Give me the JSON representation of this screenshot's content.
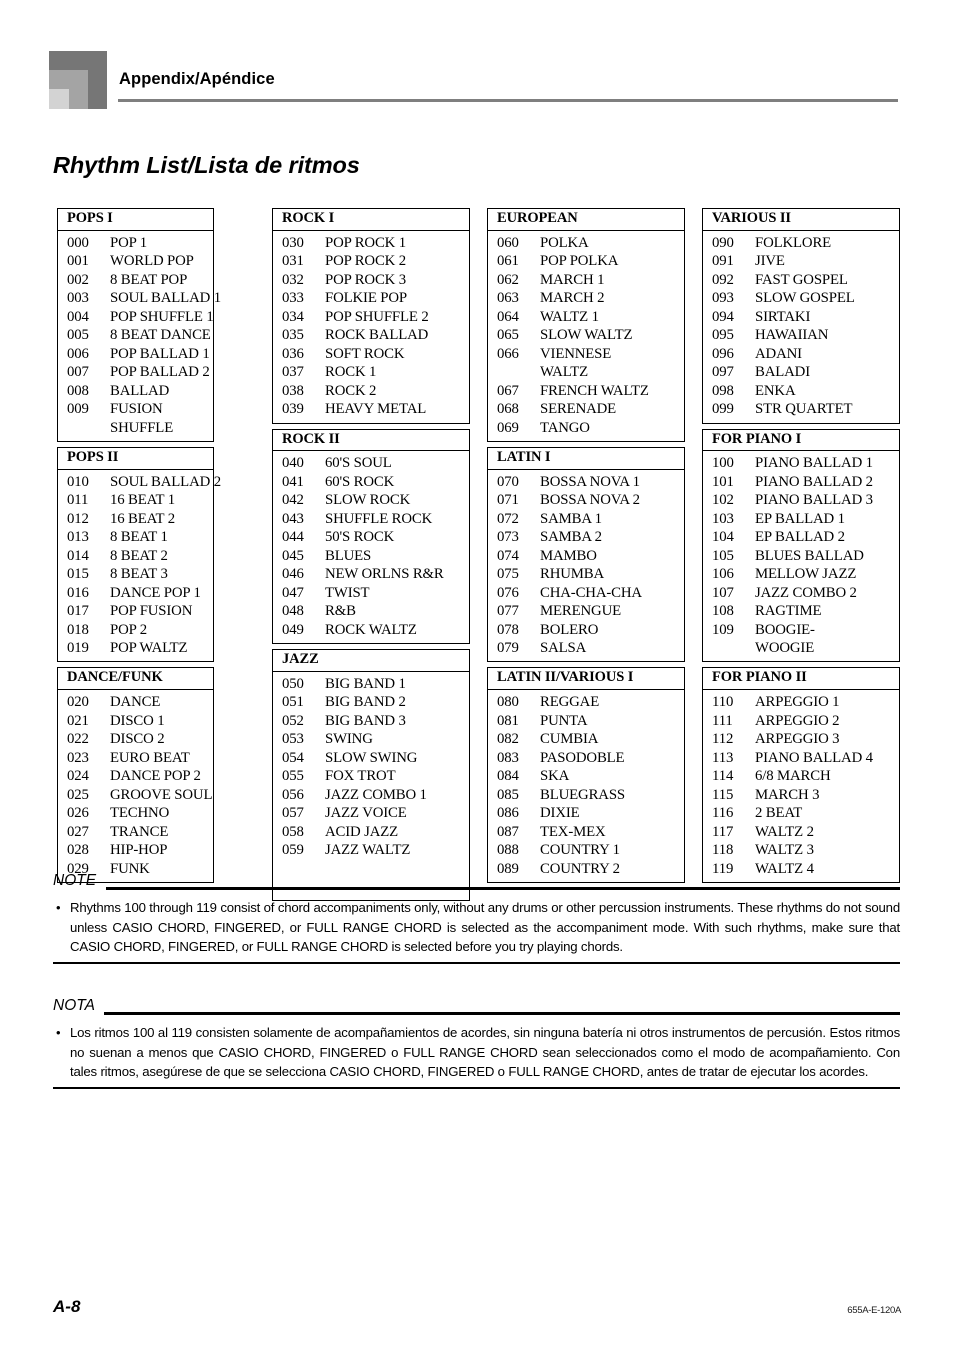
{
  "header": {
    "breadcrumb": "Appendix/Apéndice",
    "logo_icon": "stepped-squares-logo",
    "rule_color": "#7f7f7f",
    "logo_colors": [
      "#767676",
      "#a4a4a4",
      "#d3d3d3"
    ]
  },
  "page_title": "Rhythm List/Lista de ritmos",
  "columns": [
    {
      "groups": [
        {
          "title": "POPS I",
          "rows": [
            {
              "num": "000",
              "name": "POP 1"
            },
            {
              "num": "001",
              "name": "WORLD POP"
            },
            {
              "num": "002",
              "name": "8 BEAT POP"
            },
            {
              "num": "003",
              "name": "SOUL BALLAD 1"
            },
            {
              "num": "004",
              "name": "POP SHUFFLE 1"
            },
            {
              "num": "005",
              "name": "8 BEAT DANCE"
            },
            {
              "num": "006",
              "name": "POP BALLAD 1"
            },
            {
              "num": "007",
              "name": "POP BALLAD 2"
            },
            {
              "num": "008",
              "name": "BALLAD"
            },
            {
              "num": "009",
              "name": "FUSION"
            },
            {
              "num": "",
              "name": "SHUFFLE",
              "continuation": true
            }
          ]
        },
        {
          "title": "POPS II",
          "rows": [
            {
              "num": "010",
              "name": "SOUL BALLAD 2"
            },
            {
              "num": "011",
              "name": "16 BEAT 1"
            },
            {
              "num": "012",
              "name": "16 BEAT 2"
            },
            {
              "num": "013",
              "name": "8 BEAT 1"
            },
            {
              "num": "014",
              "name": "8 BEAT 2"
            },
            {
              "num": "015",
              "name": "8 BEAT 3"
            },
            {
              "num": "016",
              "name": "DANCE POP 1"
            },
            {
              "num": "017",
              "name": "POP FUSION"
            },
            {
              "num": "018",
              "name": "POP 2"
            },
            {
              "num": "019",
              "name": "POP WALTZ"
            }
          ]
        },
        {
          "title": "DANCE/FUNK",
          "rows": [
            {
              "num": "020",
              "name": "DANCE"
            },
            {
              "num": "021",
              "name": "DISCO 1"
            },
            {
              "num": "022",
              "name": "DISCO 2"
            },
            {
              "num": "023",
              "name": "EURO BEAT"
            },
            {
              "num": "024",
              "name": "DANCE POP 2"
            },
            {
              "num": "025",
              "name": "GROOVE SOUL"
            },
            {
              "num": "026",
              "name": "TECHNO"
            },
            {
              "num": "027",
              "name": "TRANCE"
            },
            {
              "num": "028",
              "name": "HIP-HOP"
            },
            {
              "num": "029",
              "name": "FUNK"
            }
          ]
        }
      ]
    },
    {
      "groups": [
        {
          "title": "ROCK I",
          "rows": [
            {
              "num": "030",
              "name": "POP ROCK 1"
            },
            {
              "num": "031",
              "name": "POP ROCK 2"
            },
            {
              "num": "032",
              "name": "POP ROCK 3"
            },
            {
              "num": "033",
              "name": "FOLKIE POP"
            },
            {
              "num": "034",
              "name": "POP SHUFFLE 2"
            },
            {
              "num": "035",
              "name": "ROCK BALLAD"
            },
            {
              "num": "036",
              "name": "SOFT ROCK"
            },
            {
              "num": "037",
              "name": "ROCK 1"
            },
            {
              "num": "038",
              "name": "ROCK 2"
            },
            {
              "num": "039",
              "name": "HEAVY METAL"
            }
          ]
        },
        {
          "title": "ROCK II",
          "rows": [
            {
              "num": "040",
              "name": "60'S SOUL"
            },
            {
              "num": "041",
              "name": "60'S ROCK"
            },
            {
              "num": "042",
              "name": "SLOW ROCK"
            },
            {
              "num": "043",
              "name": "SHUFFLE ROCK"
            },
            {
              "num": "044",
              "name": "50'S ROCK"
            },
            {
              "num": "045",
              "name": "BLUES"
            },
            {
              "num": "046",
              "name": "NEW ORLNS R&R"
            },
            {
              "num": "047",
              "name": "TWIST"
            },
            {
              "num": "048",
              "name": "R&B"
            },
            {
              "num": "049",
              "name": "ROCK WALTZ"
            }
          ]
        },
        {
          "title": "JAZZ",
          "trailing_blank_rows": 2,
          "rows": [
            {
              "num": "050",
              "name": "BIG BAND 1"
            },
            {
              "num": "051",
              "name": "BIG BAND 2"
            },
            {
              "num": "052",
              "name": "BIG BAND 3"
            },
            {
              "num": "053",
              "name": "SWING"
            },
            {
              "num": "054",
              "name": "SLOW SWING"
            },
            {
              "num": "055",
              "name": "FOX TROT"
            },
            {
              "num": "056",
              "name": "JAZZ COMBO 1"
            },
            {
              "num": "057",
              "name": "JAZZ VOICE"
            },
            {
              "num": "058",
              "name": "ACID JAZZ"
            },
            {
              "num": "059",
              "name": "JAZZ WALTZ"
            }
          ]
        }
      ]
    },
    {
      "groups": [
        {
          "title": "EUROPEAN",
          "rows": [
            {
              "num": "060",
              "name": "POLKA"
            },
            {
              "num": "061",
              "name": "POP POLKA"
            },
            {
              "num": "062",
              "name": "MARCH 1"
            },
            {
              "num": "063",
              "name": "MARCH 2"
            },
            {
              "num": "064",
              "name": "WALTZ 1"
            },
            {
              "num": "065",
              "name": "SLOW WALTZ"
            },
            {
              "num": "066",
              "name": "VIENNESE"
            },
            {
              "num": "",
              "name": "WALTZ",
              "continuation": true
            },
            {
              "num": "067",
              "name": "FRENCH WALTZ"
            },
            {
              "num": "068",
              "name": "SERENADE"
            },
            {
              "num": "069",
              "name": "TANGO"
            }
          ]
        },
        {
          "title": "LATIN I",
          "rows": [
            {
              "num": "070",
              "name": "BOSSA NOVA 1"
            },
            {
              "num": "071",
              "name": "BOSSA NOVA 2"
            },
            {
              "num": "072",
              "name": "SAMBA 1"
            },
            {
              "num": "073",
              "name": "SAMBA 2"
            },
            {
              "num": "074",
              "name": "MAMBO"
            },
            {
              "num": "075",
              "name": "RHUMBA"
            },
            {
              "num": "076",
              "name": "CHA-CHA-CHA"
            },
            {
              "num": "077",
              "name": "MERENGUE"
            },
            {
              "num": "078",
              "name": "BOLERO"
            },
            {
              "num": "079",
              "name": "SALSA"
            }
          ]
        },
        {
          "title": "LATIN II/VARIOUS I",
          "rows": [
            {
              "num": "080",
              "name": "REGGAE"
            },
            {
              "num": "081",
              "name": "PUNTA"
            },
            {
              "num": "082",
              "name": "CUMBIA"
            },
            {
              "num": "083",
              "name": "PASODOBLE"
            },
            {
              "num": "084",
              "name": "SKA"
            },
            {
              "num": "085",
              "name": "BLUEGRASS"
            },
            {
              "num": "086",
              "name": "DIXIE"
            },
            {
              "num": "087",
              "name": "TEX-MEX"
            },
            {
              "num": "088",
              "name": "COUNTRY 1"
            },
            {
              "num": "089",
              "name": "COUNTRY 2"
            }
          ]
        }
      ]
    },
    {
      "groups": [
        {
          "title": "VARIOUS II",
          "rows": [
            {
              "num": "090",
              "name": "FOLKLORE"
            },
            {
              "num": "091",
              "name": "JIVE"
            },
            {
              "num": "092",
              "name": "FAST GOSPEL"
            },
            {
              "num": "093",
              "name": "SLOW GOSPEL"
            },
            {
              "num": "094",
              "name": "SIRTAKI"
            },
            {
              "num": "095",
              "name": "HAWAIIAN"
            },
            {
              "num": "096",
              "name": "ADANI"
            },
            {
              "num": "097",
              "name": "BALADI"
            },
            {
              "num": "098",
              "name": "ENKA"
            },
            {
              "num": "099",
              "name": "STR QUARTET"
            }
          ]
        },
        {
          "title": "FOR PIANO I",
          "rows": [
            {
              "num": "100",
              "name": "PIANO BALLAD 1"
            },
            {
              "num": "101",
              "name": "PIANO BALLAD 2"
            },
            {
              "num": "102",
              "name": "PIANO BALLAD 3"
            },
            {
              "num": "103",
              "name": "EP BALLAD 1"
            },
            {
              "num": "104",
              "name": "EP BALLAD 2"
            },
            {
              "num": "105",
              "name": "BLUES BALLAD"
            },
            {
              "num": "106",
              "name": "MELLOW JAZZ"
            },
            {
              "num": "107",
              "name": "JAZZ COMBO 2"
            },
            {
              "num": "108",
              "name": "RAGTIME"
            },
            {
              "num": "109",
              "name": "BOOGIE-"
            },
            {
              "num": "",
              "name": "WOOGIE",
              "continuation": true
            }
          ]
        },
        {
          "title": "FOR PIANO II",
          "rows": [
            {
              "num": "110",
              "name": "ARPEGGIO 1"
            },
            {
              "num": "111",
              "name": "ARPEGGIO 2"
            },
            {
              "num": "112",
              "name": "ARPEGGIO 3"
            },
            {
              "num": "113",
              "name": "PIANO BALLAD 4"
            },
            {
              "num": "114",
              "name": "6/8 MARCH"
            },
            {
              "num": "115",
              "name": "MARCH 3"
            },
            {
              "num": "116",
              "name": "2 BEAT"
            },
            {
              "num": "117",
              "name": "WALTZ 2"
            },
            {
              "num": "118",
              "name": "WALTZ 3"
            },
            {
              "num": "119",
              "name": "WALTZ 4"
            }
          ]
        }
      ]
    }
  ],
  "notes": {
    "en": {
      "label": "NOTE",
      "bullet": "•",
      "text": "Rhythms 100 through 119 consist of chord accompaniments only, without any drums or other percussion instruments. These rhythms do not sound unless CASIO CHORD, FINGERED, or FULL RANGE CHORD is selected as the accompaniment mode. With such rhythms, make sure that CASIO CHORD, FINGERED, or FULL RANGE CHORD is selected before you try playing chords."
    },
    "es": {
      "label": "NOTA",
      "bullet": "•",
      "text": "Los ritmos 100 al 119 consisten solamente de acompañamientos de acordes, sin ninguna batería ni otros instrumentos de percusión. Estos ritmos no suenan a menos que CASIO CHORD, FINGERED o FULL RANGE CHORD sean seleccionados como el modo de acompañamiento. Con tales ritmos, asegúrese de que se selecciona CASIO CHORD, FINGERED o FULL RANGE CHORD, antes de tratar de ejecutar los acordes."
    }
  },
  "footer": {
    "page_number": "A-8",
    "doc_code": "655A-E-120A"
  }
}
